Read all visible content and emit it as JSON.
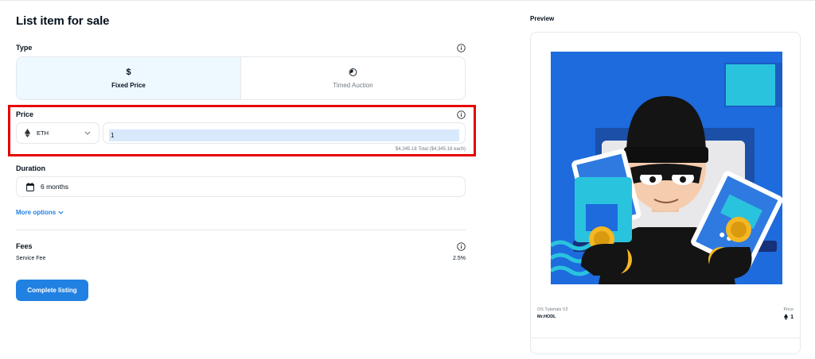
{
  "page": {
    "title": "List item for sale"
  },
  "type_section": {
    "label": "Type",
    "options": [
      {
        "icon": "$",
        "label": "Fixed Price",
        "selected": true
      },
      {
        "icon": "clock-icon",
        "label": "Timed Auction",
        "selected": false
      }
    ]
  },
  "price_section": {
    "label": "Price",
    "currency": "ETH",
    "amount": "1",
    "total_text": "$4,345.18 Total ($4,345.18 each)"
  },
  "duration_section": {
    "label": "Duration",
    "value": "6 months"
  },
  "more_options": {
    "label": "More options"
  },
  "fees": {
    "label": "Fees",
    "service_fee_label": "Service Fee",
    "service_fee_value": "2.5%"
  },
  "action": {
    "complete_label": "Complete listing"
  },
  "preview": {
    "title": "Preview",
    "collection": "OS Tutorials V2",
    "item_name": "Mr.HODL",
    "price_label": "Price",
    "price_value": "1"
  },
  "colors": {
    "accent": "#2081e2",
    "highlight": "#e50000",
    "art_bg": "#1d6bdd"
  }
}
